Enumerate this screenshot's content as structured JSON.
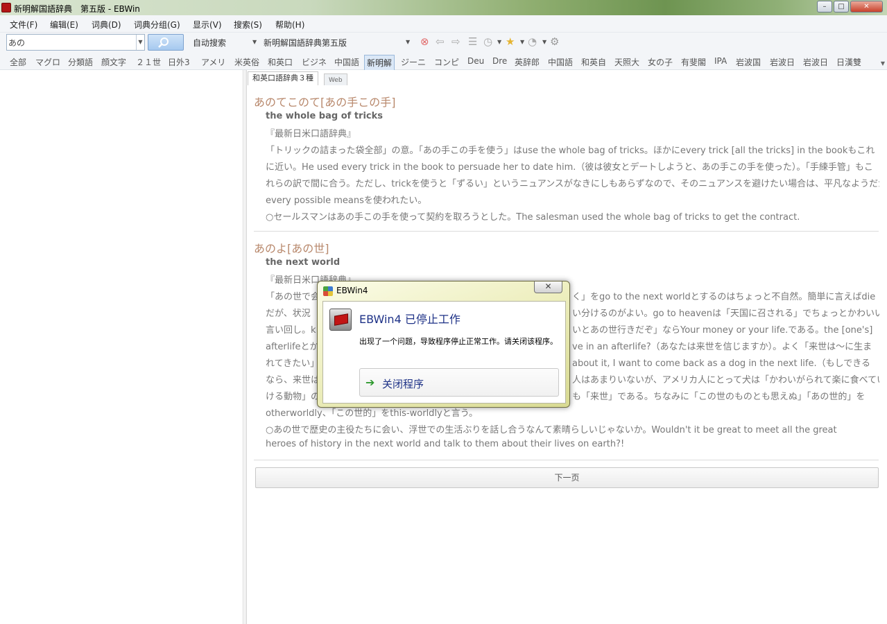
{
  "window": {
    "title": "新明解国語辞典　第五版 - EBWin",
    "app_icon": "ebwin-app-icon",
    "controls": {
      "minimize": "–",
      "maximize": "□",
      "close": "✕"
    }
  },
  "menu": [
    "文件(F)",
    "编辑(E)",
    "词典(D)",
    "词典分组(G)",
    "显示(V)",
    "搜索(S)",
    "帮助(H)"
  ],
  "toolbar": {
    "search_value": "あの",
    "search_icon": "magnifier-icon",
    "search_mode": "自动搜索",
    "dictionary": "新明解国語辞典第五版",
    "icons": [
      "stop-icon",
      "back-icon",
      "forward-icon",
      "list-icon",
      "history-icon",
      "favorite-star-icon",
      "clock-icon",
      "gear-icon"
    ]
  },
  "dict_groups": [
    {
      "label": "全部",
      "active": false
    },
    {
      "label": "マグロ",
      "active": false
    },
    {
      "label": "分類語",
      "active": false
    },
    {
      "label": "顔文字",
      "active": false
    },
    {
      "label": "２１世",
      "active": false
    },
    {
      "label": "日外3",
      "active": false
    },
    {
      "label": "アメリ",
      "active": false
    },
    {
      "label": "米英俗",
      "active": false
    },
    {
      "label": "和英口",
      "active": false
    },
    {
      "label": "ビジネ",
      "active": false
    },
    {
      "label": "中国語",
      "active": false
    },
    {
      "label": "新明解",
      "active": true
    },
    {
      "label": "ジーニ",
      "active": false
    },
    {
      "label": "コンピ",
      "active": false
    },
    {
      "label": "Deu",
      "active": false
    },
    {
      "label": "Dre",
      "active": false
    },
    {
      "label": "英辞郎",
      "active": false
    },
    {
      "label": "中国語",
      "active": false
    },
    {
      "label": "和英自",
      "active": false
    },
    {
      "label": "天照大",
      "active": false
    },
    {
      "label": "女の子",
      "active": false
    },
    {
      "label": "有斐閣",
      "active": false
    },
    {
      "label": "IPA",
      "active": false
    },
    {
      "label": "岩波国",
      "active": false
    },
    {
      "label": "岩波日",
      "active": false
    },
    {
      "label": "岩波日",
      "active": false
    },
    {
      "label": "日漢雙",
      "active": false
    }
  ],
  "content_tabs": [
    "和英口語辞典３種",
    "Web"
  ],
  "entries": [
    {
      "headword": "あのてこのて[あの手この手]",
      "translation": "the whole bag of tricks",
      "lines": [
        "『最新日米口語辞典』",
        "「トリックの詰まった袋全部」の意。「あの手この手を使う」はuse the whole bag of tricks。ほかにevery trick [all the tricks] in the bookもこれ",
        "に近い。He used every trick in the book to persuade her to date him.（彼は彼女とデートしようと、あの手この手を使った）。「手練手管」もこ",
        "れらの訳で間に合う。ただし、trickを使うと「ずるい」というニュアンスがなきにしもあらずなので、そのニュアンスを避けたい場合は、平凡なようだが",
        "every possible meansを使われたい。",
        "○セールスマンはあの手この手を使って契約を取ろうとした。The salesman used the whole bag of tricks to get the contract."
      ]
    },
    {
      "headword": "あのよ[あの世]",
      "translation": "the next world",
      "lines": [
        "『最新日米口語辞典』",
        "「あの世で会",
        "だが、状況",
        "言い回し。k",
        "afterlifeとか",
        "れてきたい」",
        "なら、来世は",
        "ける動物」の",
        "otherworldly、「この世的」をthis-worldlyと言う。",
        "○あの世で歴史の主役たちに会い、浮世での生活ぶりを話し合うなんて素晴らしいじゃないか。Wouldn't it be great to meet all the great",
        "heroes of history in the next world and talk to them about their lives on earth?!"
      ],
      "right_fragments": [
        "く」をgo to the next worldとするのはちょっと不自然。簡単に言えばdie",
        "い分けるのがよい。go to heavenは「天国に召される」でちょっとかわいい",
        "いとあの世行きだぞ」ならYour money or your life.である。the [one's]",
        "ve in an afterlife?（あなたは来世を信じますか）。よく「来世は～に生ま",
        "about it, I want to come back as a dog in the next life.（もしできる",
        "人はあまりいないが、アメリカ人にとって犬は「かわいがられて楽に食べてい",
        "も「来世」である。ちなみに「この世のものとも思えぬ」「あの世的」を"
      ]
    }
  ],
  "next_page": "下一页",
  "dialog": {
    "title": "EBWin4",
    "heading": "EBWin4 已停止工作",
    "message": "出现了一个问题，导致程序停止正常工作。请关闭该程序。",
    "button": "关闭程序",
    "close_glyph": "✕",
    "title_icon": "windows-flag-icon",
    "program_icon": "ebwin-program-icon",
    "button_icon": "green-arrow-icon"
  }
}
